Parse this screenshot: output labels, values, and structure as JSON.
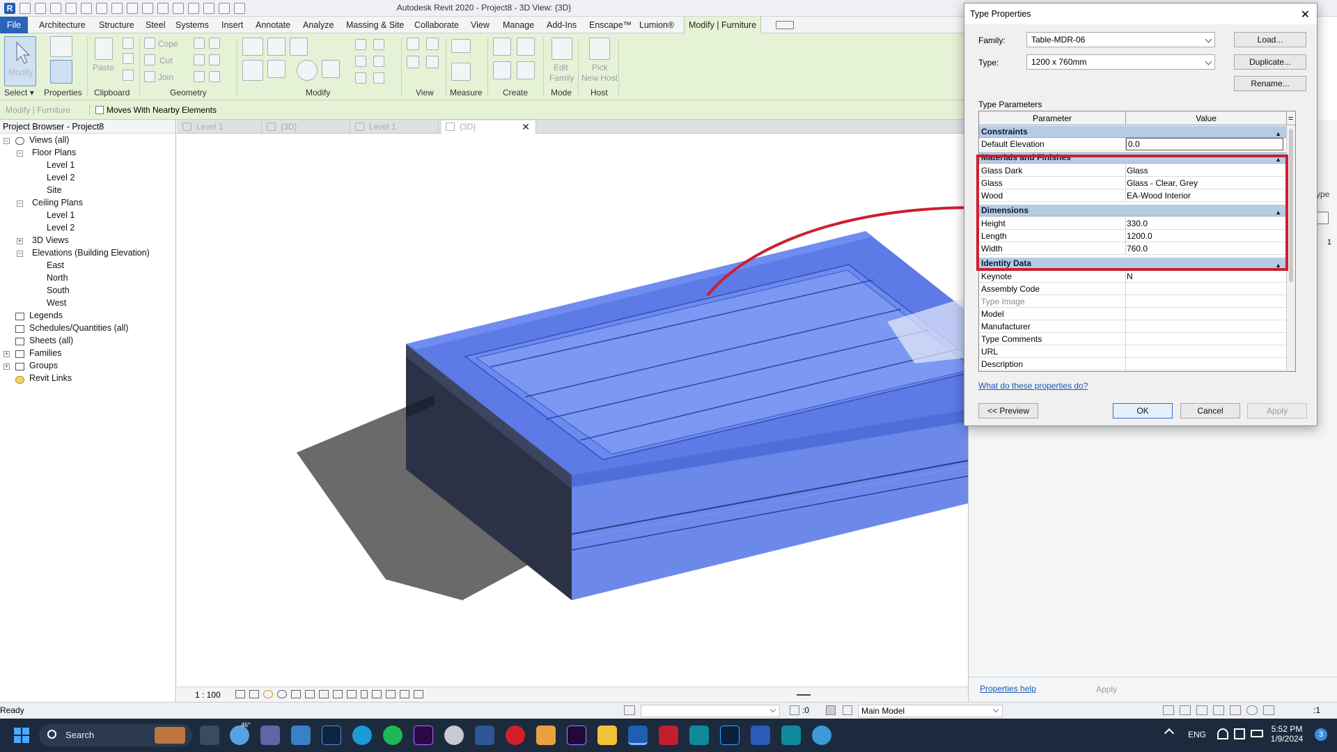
{
  "window": {
    "title": "Autodesk Revit 2020 - Project8 - 3D View: {3D}"
  },
  "menu": {
    "tabs": [
      "File",
      "Architecture",
      "Structure",
      "Steel",
      "Systems",
      "Insert",
      "Annotate",
      "Analyze",
      "Massing & Site",
      "Collaborate",
      "View",
      "Manage",
      "Add-Ins",
      "Enscape™",
      "Lumion®",
      "Modify | Furniture"
    ]
  },
  "ribbon": {
    "panels": [
      "Select",
      "Properties",
      "Clipboard",
      "Geometry",
      "Modify",
      "View",
      "Measure",
      "Create",
      "Mode",
      "Host"
    ],
    "buttons": {
      "modify": "Modify",
      "paste": "Paste",
      "cope": "Cope",
      "cut": "Cut",
      "join": "Join",
      "edit_family_1": "Edit",
      "edit_family_2": "Family",
      "pick_host_1": "Pick",
      "pick_host_2": "New Host"
    }
  },
  "optionsbar": {
    "context": "Modify | Furniture",
    "moves_label": "Moves With Nearby Elements"
  },
  "browser": {
    "title": "Project Browser - Project8",
    "views_all": "Views (all)",
    "floor_plans": "Floor Plans",
    "fp_items": [
      "Level 1",
      "Level 2",
      "Site"
    ],
    "ceiling_plans": "Ceiling Plans",
    "cp_items": [
      "Level 1",
      "Level 2"
    ],
    "views_3d": "3D Views",
    "elevations": "Elevations (Building Elevation)",
    "el_items": [
      "East",
      "North",
      "South",
      "West"
    ],
    "legends": "Legends",
    "schedules": "Schedules/Quantities (all)",
    "sheets": "Sheets (all)",
    "families": "Families",
    "groups": "Groups",
    "revit_links": "Revit Links"
  },
  "viewtabs": [
    "Level 1",
    "{3D}",
    "Level 1",
    "{3D}"
  ],
  "viewcontrol": {
    "scale": "1 : 100"
  },
  "status": {
    "ready": "Ready",
    "zero": ":0",
    "workset": "Main Model",
    "filter": ":1"
  },
  "rightpanel": {
    "type_hint": "ype",
    "props_help": "Properties help",
    "apply": "Apply",
    "num": "1"
  },
  "dialog": {
    "title": "Type Properties",
    "family_label": "Family:",
    "family_value": "Table-MDR-06",
    "type_label": "Type:",
    "type_value": "1200 x 760mm",
    "load": "Load...",
    "duplicate": "Duplicate...",
    "rename": "Rename...",
    "type_params": "Type Parameters",
    "col_param": "Parameter",
    "col_value": "Value",
    "col_eq": "=",
    "groups": {
      "constraints": "Constraints",
      "materials": "Materials and Finishes",
      "dimensions": "Dimensions",
      "identity": "Identity Data"
    },
    "rows": {
      "default_elevation": [
        "Default Elevation",
        "0.0"
      ],
      "glass_dark": [
        "Glass Dark",
        "Glass"
      ],
      "glass": [
        "Glass",
        "Glass - Clear, Grey"
      ],
      "wood": [
        "Wood",
        "EA-Wood Interior"
      ],
      "height": [
        "Height",
        "330.0"
      ],
      "length": [
        "Length",
        "1200.0"
      ],
      "width": [
        "Width",
        "760.0"
      ],
      "keynote": [
        "Keynote",
        "N"
      ],
      "assembly_code": [
        "Assembly Code",
        ""
      ],
      "type_image": [
        "Type Image",
        ""
      ],
      "model": [
        "Model",
        ""
      ],
      "manufacturer": [
        "Manufacturer",
        ""
      ],
      "type_comments": [
        "Type Comments",
        ""
      ],
      "url": [
        "URL",
        ""
      ],
      "description": [
        "Description",
        ""
      ]
    },
    "help_link": "What do these properties do?",
    "preview": "<< Preview",
    "ok": "OK",
    "cancel": "Cancel",
    "apply": "Apply"
  },
  "taskbar": {
    "search": "Search",
    "weather": "46°",
    "lang": "ENG",
    "time": "5:52 PM",
    "date": "1/9/2024",
    "badge": "3",
    "apps": [
      "task-view",
      "weather",
      "teams",
      "photos",
      "lightroom",
      "edge",
      "spotify",
      "premiere",
      "app-circle",
      "calculator-12",
      "opera",
      "movies",
      "after-effects",
      "file-explorer",
      "revit",
      "autocad",
      "3dsmax",
      "photoshop",
      "word",
      "3dsmax-2",
      "browser"
    ]
  },
  "colors": {
    "accent_ribbon": "#e6f2d6",
    "file_tab": "#2a64b6",
    "highlight_box": "#cc1f2e",
    "model_blue": "#4a6fe0",
    "taskbar": "#1c2a3d"
  }
}
